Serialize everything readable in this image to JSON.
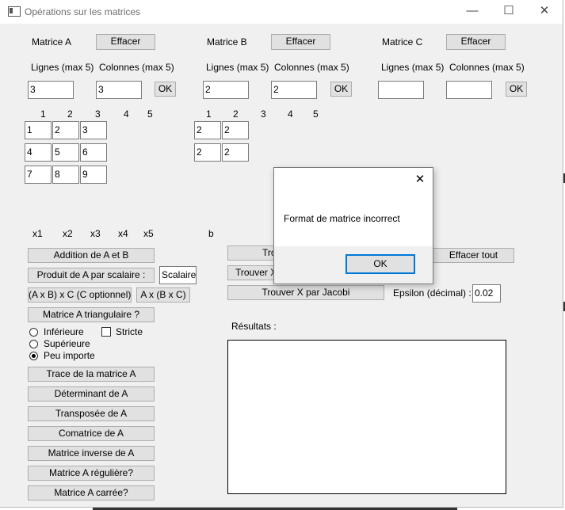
{
  "window": {
    "title": "Opérations sur les matrices"
  },
  "matrixA": {
    "label": "Matrice A",
    "clear": "Effacer",
    "rows_label": "Lignes (max 5)",
    "cols_label": "Colonnes (max 5)",
    "rows": "3",
    "cols": "3",
    "ok": "OK",
    "col_headers": [
      "1",
      "2",
      "3",
      "4",
      "5"
    ],
    "cells": [
      [
        "1",
        "2",
        "3"
      ],
      [
        "4",
        "5",
        "6"
      ],
      [
        "7",
        "8",
        "9"
      ]
    ]
  },
  "matrixB": {
    "label": "Matrice B",
    "clear": "Effacer",
    "rows_label": "Lignes (max 5)",
    "cols_label": "Colonnes (max 5)",
    "rows": "2",
    "cols": "2",
    "ok": "OK",
    "col_headers": [
      "1",
      "2",
      "3",
      "4",
      "5"
    ],
    "cells": [
      [
        "2",
        "2"
      ],
      [
        "2",
        "2"
      ]
    ]
  },
  "matrixC": {
    "label": "Matrice C",
    "clear": "Effacer",
    "rows_label": "Lignes (max 5)",
    "cols_label": "Colonnes (max 5)",
    "rows": "",
    "cols": "",
    "ok": "OK"
  },
  "system": {
    "x_labels": [
      "x1",
      "x2",
      "x3",
      "x4",
      "x5"
    ],
    "b_label": "b"
  },
  "ops": {
    "add": "Addition de A et B",
    "scalar_product": "Produit de A par scalaire :",
    "scalar_value": "Scalaire",
    "axb_c": "(A x B) x C (C optionnel)",
    "a_bxc": "A x (B x C)",
    "triangular": "Matrice A triangulaire ?",
    "lower": "Inférieure",
    "strict": "Stricte",
    "upper": "Supérieure",
    "any": "Peu importe",
    "trace": "Trace de la matrice A",
    "determinant": "Déterminant de A",
    "transpose": "Transposée de A",
    "comatrix": "Comatrice de A",
    "inverse": "Matrice inverse de A",
    "regular": "Matrice A régulière?",
    "square": "Matrice A carrée?"
  },
  "solve": {
    "gauss_partial": "Tro",
    "trouver_partial": "Trouver X",
    "jacobi": "Trouver X par Jacobi",
    "clear_all": "Effacer tout",
    "epsilon_label": "Epsilon (décimal) :",
    "epsilon_value": "0.02",
    "results_label": "Résultats :"
  },
  "dialog": {
    "message": "Format de matrice incorrect",
    "ok": "OK",
    "close": "✕"
  },
  "controls": {
    "minimize": "—",
    "maximize": "☐",
    "close": "✕"
  }
}
